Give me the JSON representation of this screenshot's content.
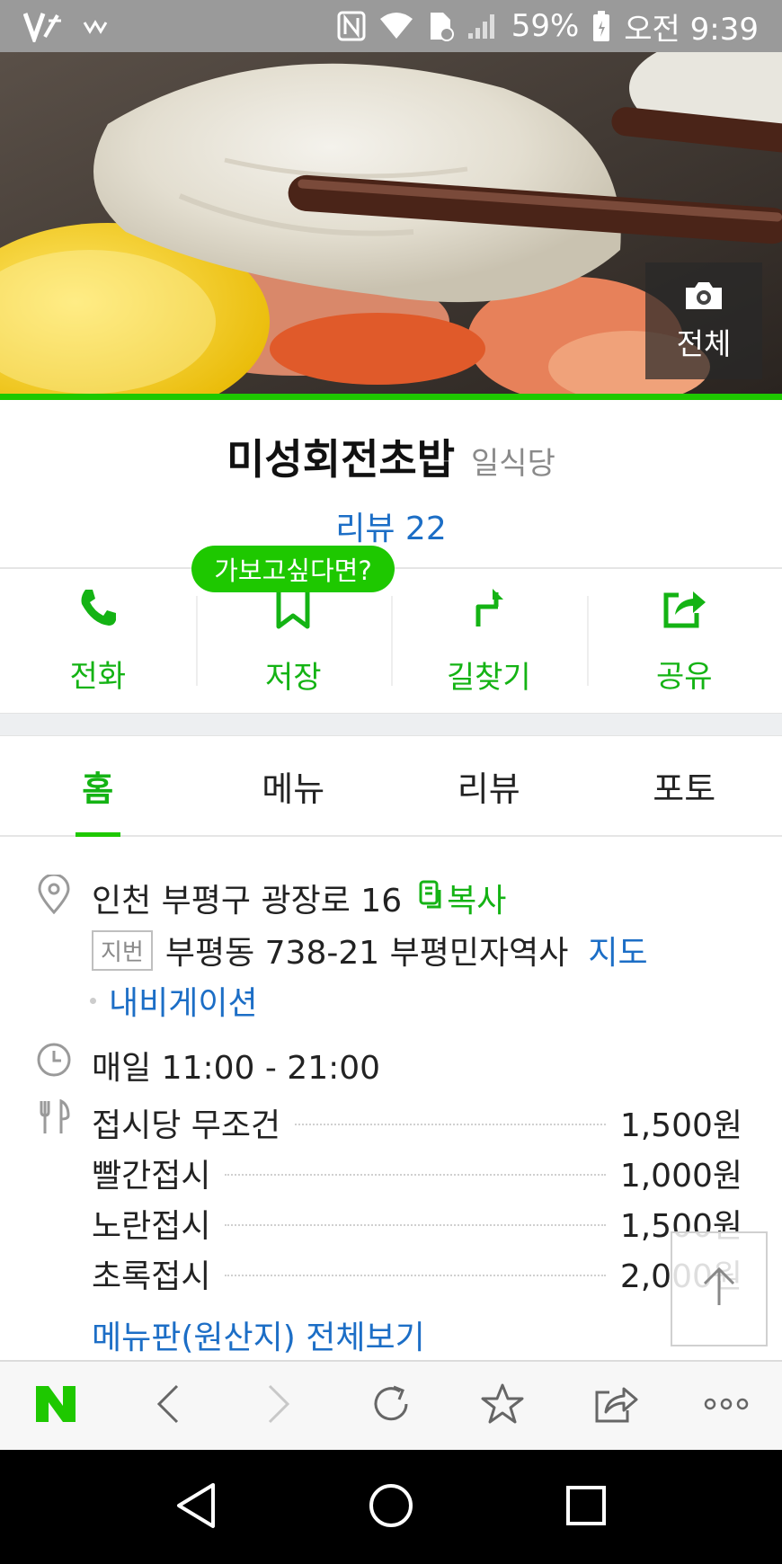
{
  "status_bar": {
    "battery": "59%",
    "time": "오전 9:39"
  },
  "hero": {
    "photo_all_label": "전체"
  },
  "place": {
    "name": "미성회전초밥",
    "category": "일식당",
    "review_label": "리뷰 22"
  },
  "tooltip": "가보고싶다면?",
  "actions": [
    {
      "label": "전화",
      "icon": "phone-icon"
    },
    {
      "label": "저장",
      "icon": "bookmark-icon"
    },
    {
      "label": "길찾기",
      "icon": "directions-icon"
    },
    {
      "label": "공유",
      "icon": "share-icon"
    }
  ],
  "tabs": [
    {
      "label": "홈",
      "active": true
    },
    {
      "label": "메뉴",
      "active": false
    },
    {
      "label": "리뷰",
      "active": false
    },
    {
      "label": "포토",
      "active": false
    }
  ],
  "address": {
    "road": "인천 부평구 광장로 16",
    "copy_label": "복사",
    "jibun_badge": "지번",
    "jibun": "부평동 738-21 부평민자역사",
    "map_label": "지도",
    "navigation_label": "내비게이션"
  },
  "hours": "매일 11:00 - 21:00",
  "menu": [
    {
      "name": "접시당 무조건",
      "price": "1,500원"
    },
    {
      "name": "빨간접시",
      "price": "1,000원"
    },
    {
      "name": "노란접시",
      "price": "1,500원"
    },
    {
      "name": "초록접시",
      "price": "2,000원"
    }
  ],
  "menu_all_label": "메뉴판(원산지) 전체보기",
  "colors": {
    "accent_green": "#1ec800",
    "text_green": "#14b314",
    "link_blue": "#1c6ec6"
  }
}
